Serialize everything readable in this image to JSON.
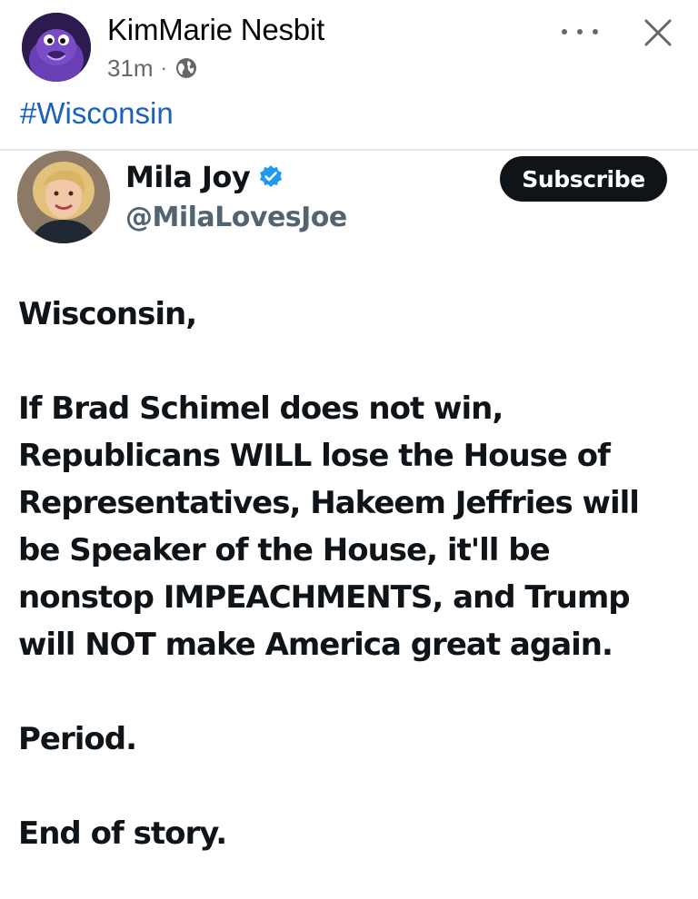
{
  "post": {
    "author": "KimMarie Nesbit",
    "time": "31m",
    "separator": "·",
    "audience_icon": "globe-icon",
    "hashtag": "#Wisconsin",
    "more_icon": "more-horizontal-icon",
    "close_icon": "close-icon"
  },
  "tweet": {
    "name": "Mila Joy",
    "handle": "@MilaLovesJoe",
    "verified_icon": "verified-badge-icon",
    "subscribe_label": "Subscribe",
    "verified_color": "#1d9bf0",
    "lines": {
      "l1": "Wisconsin,",
      "l2": "If Brad Schimel does not win,",
      "l3": "Republicans WILL lose the House of",
      "l4": "Representatives, Hakeem Jeffries will",
      "l5": "be Speaker of the House, it'll be",
      "l6": "nonstop IMPEACHMENTS, and Trump",
      "l7": "will NOT make America great again.",
      "l8": "Period.",
      "l9": "End of story."
    }
  },
  "colors": {
    "link": "#1b5fbf",
    "secondary_text": "#65676b",
    "subscribe_bg": "#0f1419"
  }
}
